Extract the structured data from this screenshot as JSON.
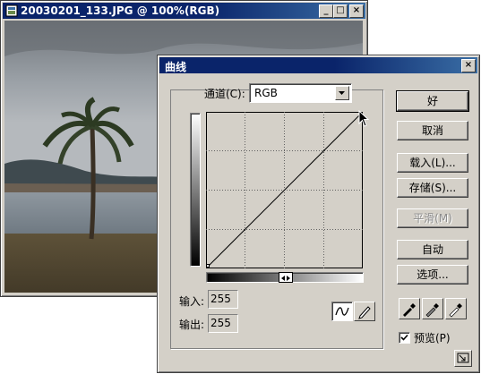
{
  "image_window": {
    "title": "20030201_133.JPG @ 100%(RGB)",
    "controls": {
      "minimize": "_",
      "maximize": "□",
      "close": "×"
    }
  },
  "curves_dialog": {
    "title": "曲线",
    "close": "×",
    "channel_label": "通道(C):",
    "channel_value": "RGB",
    "buttons": {
      "ok": "好",
      "cancel": "取消",
      "load": "载入(L)...",
      "save": "存储(S)...",
      "smooth": "平滑(M)",
      "auto": "自动",
      "options": "选项..."
    },
    "input_label": "输入:",
    "input_value": "255",
    "output_label": "输出:",
    "output_value": "255",
    "preview_label": "预览(P)",
    "preview_checked": true,
    "icons": [
      "curve-tool-icon",
      "pencil-tool-icon",
      "black-eyedropper-icon",
      "gray-eyedropper-icon",
      "white-eyedropper-icon",
      "expand-icon"
    ],
    "colors": {
      "title_bar": "#0a246a",
      "face": "#d4d0c8"
    }
  }
}
